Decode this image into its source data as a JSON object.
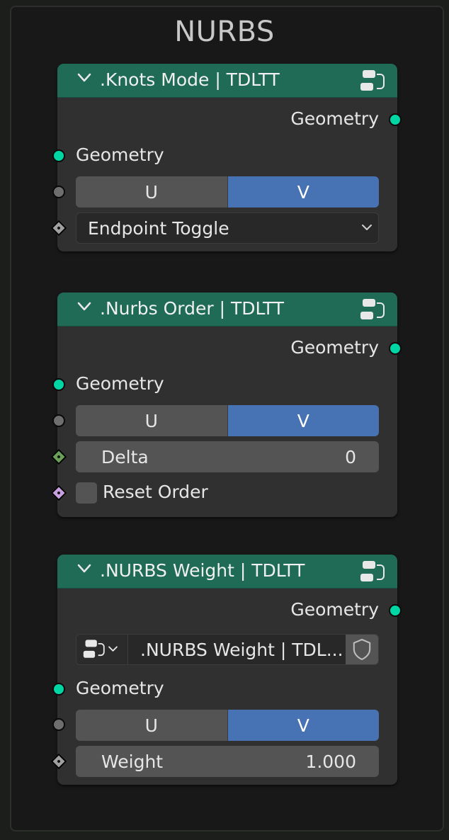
{
  "frame": {
    "title": "NURBS"
  },
  "nodes": [
    {
      "title": ".Knots Mode | TDLTT",
      "output": "Geometry",
      "input": "Geometry",
      "toggle": {
        "left": "U",
        "right": "V",
        "selected": "V"
      },
      "dropdown": "Endpoint Toggle"
    },
    {
      "title": ".Nurbs Order | TDLTT",
      "output": "Geometry",
      "input": "Geometry",
      "toggle": {
        "left": "U",
        "right": "V",
        "selected": "V"
      },
      "field": {
        "label": "Delta",
        "value": "0"
      },
      "checkbox": {
        "label": "Reset Order",
        "checked": false
      }
    },
    {
      "title": ".NURBS Weight | TDLTT",
      "output": "Geometry",
      "group_select": ".NURBS Weight | TDL...",
      "input": "Geometry",
      "toggle": {
        "left": "U",
        "right": "V",
        "selected": "V"
      },
      "field": {
        "label": "Weight",
        "value": "1.000"
      }
    }
  ],
  "icons": {
    "collapse": "chevron-down-icon",
    "node_group": "node-group-icon",
    "fake_user": "shield-icon",
    "dropdown": "chevron-down-icon"
  },
  "colors": {
    "header": "#1f6b55",
    "geometry_socket": "#00d6a3",
    "toggle_active": "#4772b3",
    "integer_socket": "#6aa05a",
    "boolean_socket": "#c8a0e0"
  }
}
